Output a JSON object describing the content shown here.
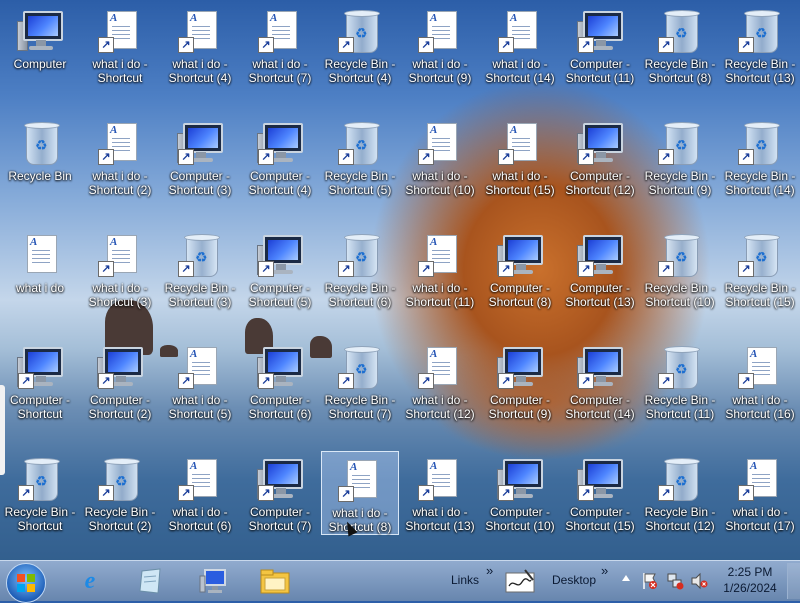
{
  "desktop": {
    "icons": [
      {
        "type": "computer",
        "label": "Computer",
        "shortcut": false
      },
      {
        "type": "doc",
        "label": "what i do - Shortcut",
        "shortcut": true
      },
      {
        "type": "doc",
        "label": "what i do - Shortcut (4)",
        "shortcut": true
      },
      {
        "type": "doc",
        "label": "what i do - Shortcut (7)",
        "shortcut": true
      },
      {
        "type": "bin",
        "label": "Recycle Bin - Shortcut (4)",
        "shortcut": true
      },
      {
        "type": "doc",
        "label": "what i do - Shortcut (9)",
        "shortcut": true
      },
      {
        "type": "doc",
        "label": "what i do - Shortcut (14)",
        "shortcut": true
      },
      {
        "type": "computer",
        "label": "Computer - Shortcut (11)",
        "shortcut": true
      },
      {
        "type": "bin",
        "label": "Recycle Bin - Shortcut (8)",
        "shortcut": true
      },
      {
        "type": "bin",
        "label": "Recycle Bin - Shortcut (13)",
        "shortcut": true
      },
      {
        "type": "bin",
        "label": "Recycle Bin",
        "shortcut": false
      },
      {
        "type": "doc",
        "label": "what i do - Shortcut (2)",
        "shortcut": true
      },
      {
        "type": "computer",
        "label": "Computer - Shortcut (3)",
        "shortcut": true
      },
      {
        "type": "computer",
        "label": "Computer - Shortcut (4)",
        "shortcut": true
      },
      {
        "type": "bin",
        "label": "Recycle Bin - Shortcut (5)",
        "shortcut": true
      },
      {
        "type": "doc",
        "label": "what i do - Shortcut (10)",
        "shortcut": true
      },
      {
        "type": "doc",
        "label": "what i do - Shortcut (15)",
        "shortcut": true
      },
      {
        "type": "computer",
        "label": "Computer - Shortcut (12)",
        "shortcut": true
      },
      {
        "type": "bin",
        "label": "Recycle Bin - Shortcut (9)",
        "shortcut": true
      },
      {
        "type": "bin",
        "label": "Recycle Bin - Shortcut (14)",
        "shortcut": true
      },
      {
        "type": "doc",
        "label": "what i do",
        "shortcut": false
      },
      {
        "type": "doc",
        "label": "what i do - Shortcut (3)",
        "shortcut": true
      },
      {
        "type": "bin",
        "label": "Recycle Bin - Shortcut (3)",
        "shortcut": true
      },
      {
        "type": "computer",
        "label": "Computer - Shortcut (5)",
        "shortcut": true
      },
      {
        "type": "bin",
        "label": "Recycle Bin - Shortcut (6)",
        "shortcut": true
      },
      {
        "type": "doc",
        "label": "what i do - Shortcut (11)",
        "shortcut": true
      },
      {
        "type": "computer",
        "label": "Computer - Shortcut (8)",
        "shortcut": true
      },
      {
        "type": "computer",
        "label": "Computer - Shortcut (13)",
        "shortcut": true
      },
      {
        "type": "bin",
        "label": "Recycle Bin - Shortcut (10)",
        "shortcut": true
      },
      {
        "type": "bin",
        "label": "Recycle Bin - Shortcut (15)",
        "shortcut": true
      },
      {
        "type": "computer",
        "label": "Computer - Shortcut",
        "shortcut": true
      },
      {
        "type": "computer",
        "label": "Computer - Shortcut (2)",
        "shortcut": true
      },
      {
        "type": "doc",
        "label": "what i do - Shortcut (5)",
        "shortcut": true
      },
      {
        "type": "computer",
        "label": "Computer - Shortcut (6)",
        "shortcut": true
      },
      {
        "type": "bin",
        "label": "Recycle Bin - Shortcut (7)",
        "shortcut": true
      },
      {
        "type": "doc",
        "label": "what i do - Shortcut (12)",
        "shortcut": true
      },
      {
        "type": "computer",
        "label": "Computer - Shortcut (9)",
        "shortcut": true
      },
      {
        "type": "computer",
        "label": "Computer - Shortcut (14)",
        "shortcut": true
      },
      {
        "type": "bin",
        "label": "Recycle Bin - Shortcut (11)",
        "shortcut": true
      },
      {
        "type": "doc",
        "label": "what i do - Shortcut (16)",
        "shortcut": true
      },
      {
        "type": "bin",
        "label": "Recycle Bin - Shortcut",
        "shortcut": true
      },
      {
        "type": "bin",
        "label": "Recycle Bin - Shortcut (2)",
        "shortcut": true
      },
      {
        "type": "doc",
        "label": "what i do - Shortcut (6)",
        "shortcut": true
      },
      {
        "type": "computer",
        "label": "Computer - Shortcut (7)",
        "shortcut": true
      },
      {
        "type": "doc",
        "label": "what i do - Shortcut (8)",
        "shortcut": true,
        "selected": true
      },
      {
        "type": "doc",
        "label": "what i do - Shortcut (13)",
        "shortcut": true
      },
      {
        "type": "computer",
        "label": "Computer - Shortcut (10)",
        "shortcut": true
      },
      {
        "type": "computer",
        "label": "Computer - Shortcut (15)",
        "shortcut": true
      },
      {
        "type": "bin",
        "label": "Recycle Bin - Shortcut (12)",
        "shortcut": true
      },
      {
        "type": "doc",
        "label": "what i do - Shortcut (17)",
        "shortcut": true
      }
    ]
  },
  "taskbar": {
    "start_icon": "windows-start-orb-icon",
    "pinned": [
      {
        "name": "internet-explorer-icon"
      },
      {
        "name": "notepad-icon"
      },
      {
        "name": "computer-icon"
      },
      {
        "name": "file-explorer-icon"
      }
    ],
    "links_label": "Links",
    "desktop_label": "Desktop",
    "chevron": "»",
    "time": "2:25 PM",
    "date": "1/26/2024"
  },
  "colors": {
    "accent": "#1d6fd0",
    "taskbar": "#7f9ec6"
  }
}
